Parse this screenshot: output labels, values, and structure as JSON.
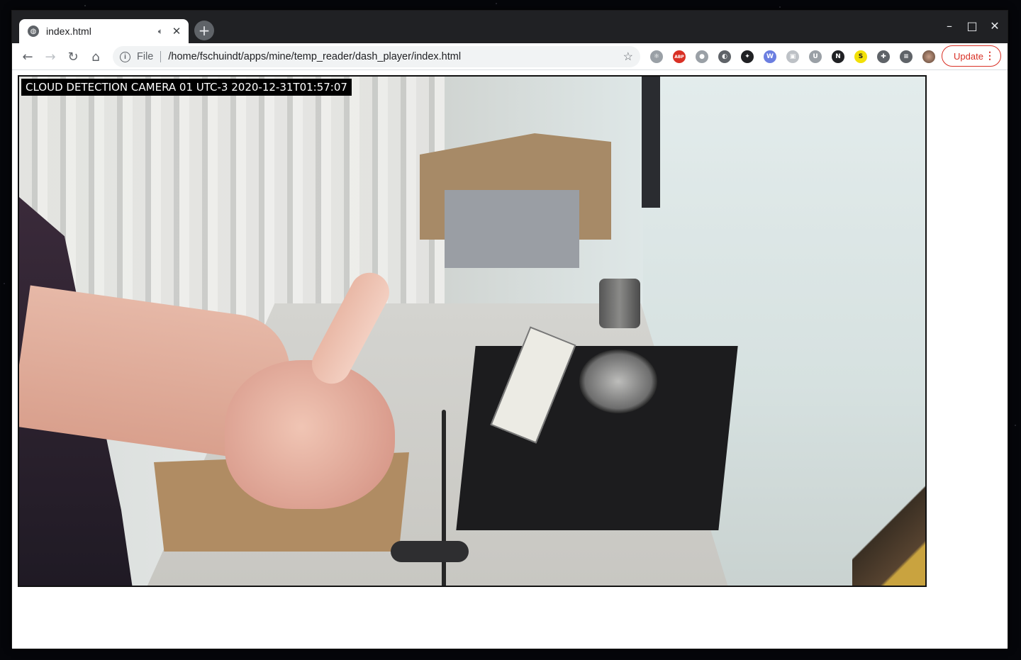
{
  "browser": {
    "tab": {
      "title": "index.html",
      "audio_icon": "speaker-icon",
      "close_glyph": "✕"
    },
    "new_tab_glyph": "+",
    "window_controls": {
      "minimize": "–",
      "maximize": "□",
      "close": "✕"
    },
    "toolbar": {
      "back_glyph": "←",
      "forward_glyph": "→",
      "reload_glyph": "↻",
      "home_glyph": "⌂",
      "scheme_label": "File",
      "url": "/home/fschuindt/apps/mine/temp_reader/dash_player/index.html",
      "star_glyph": "☆",
      "update_label": "Update",
      "menu_glyph": "⋮"
    },
    "extensions": [
      {
        "name": "react-devtools-icon",
        "glyph": "⚛",
        "color": "#9aa0a6"
      },
      {
        "name": "adblock-plus-icon",
        "glyph": "ABP",
        "color": "#d93025"
      },
      {
        "name": "discord-icon",
        "glyph": "●",
        "color": "#9aa0a6"
      },
      {
        "name": "circle-icon",
        "glyph": "◐",
        "color": "#5f6368"
      },
      {
        "name": "gnome-icon",
        "glyph": "✦",
        "color": "#202124"
      },
      {
        "name": "wappalyzer-icon",
        "glyph": "W",
        "color": "#6b7ee0"
      },
      {
        "name": "video-icon",
        "glyph": "▣",
        "color": "#bdc1c6"
      },
      {
        "name": "user-icon",
        "glyph": "U",
        "color": "#9aa0a6"
      },
      {
        "name": "notion-icon",
        "glyph": "N",
        "color": "#202124"
      },
      {
        "name": "s-extension-icon",
        "glyph": "S",
        "color": "#f2e007"
      },
      {
        "name": "puzzle-icon",
        "glyph": "✚",
        "color": "#5f6368"
      },
      {
        "name": "media-control-icon",
        "glyph": "≡",
        "color": "#5f6368"
      }
    ]
  },
  "page": {
    "overlay_text": "CLOUD DETECTION CAMERA 01 UTC-3 2020-12-31T01:57:07"
  }
}
